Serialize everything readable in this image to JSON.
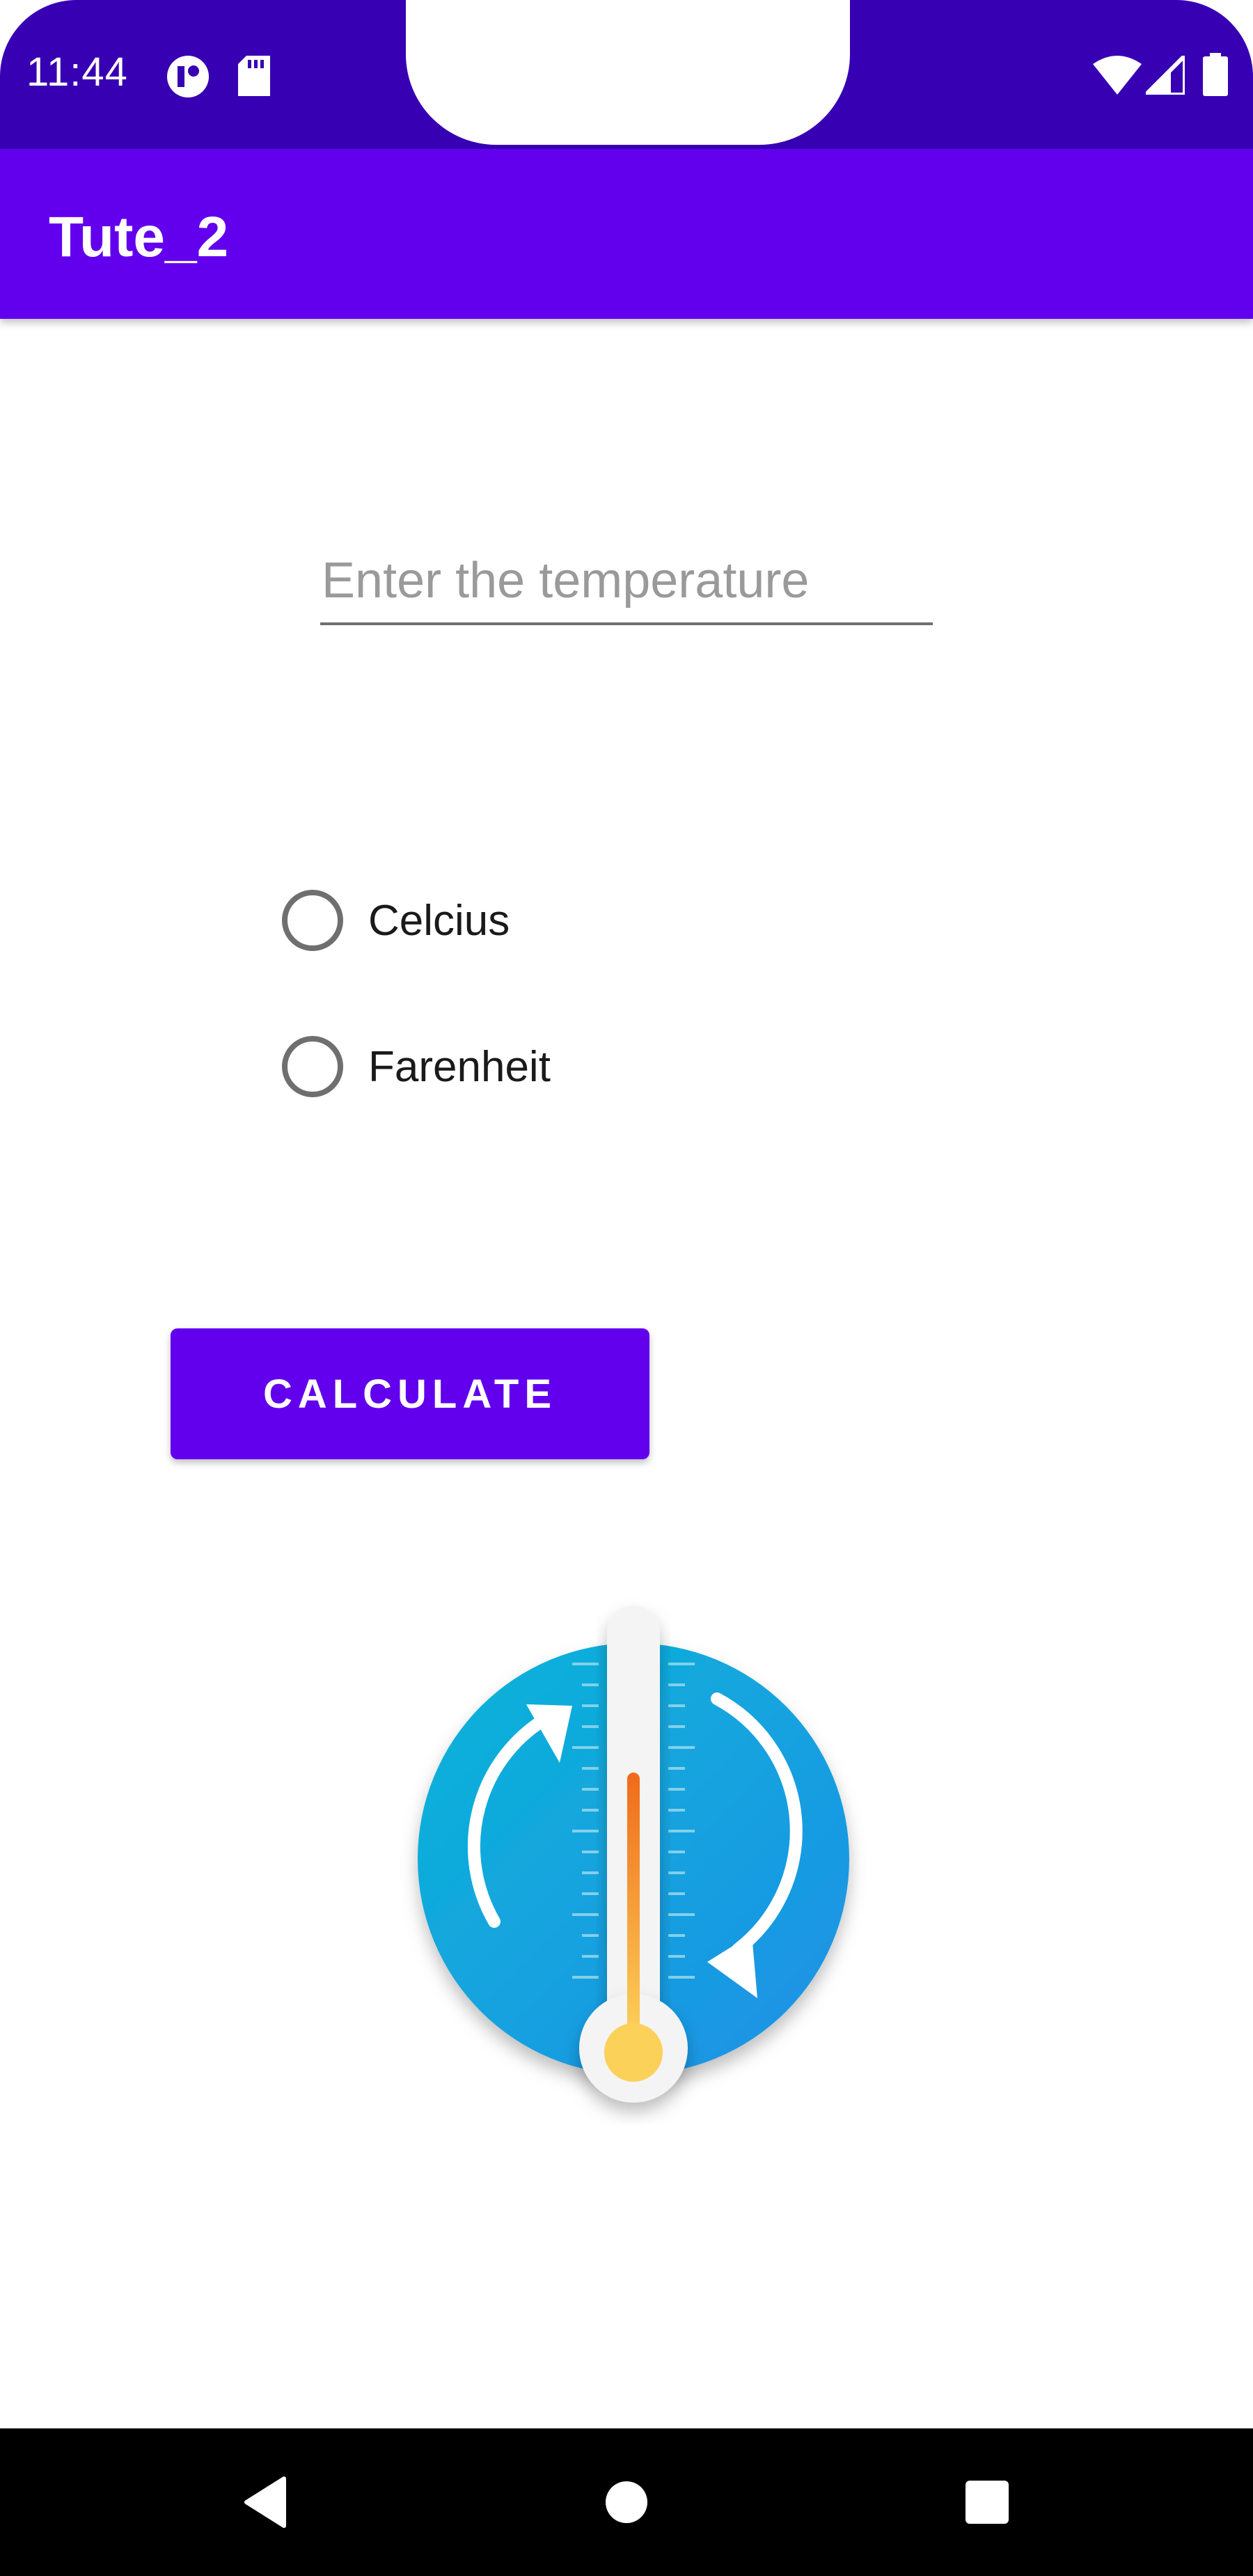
{
  "status_bar": {
    "time": "11:44",
    "icons": [
      "circle-app-icon",
      "sd-card-icon",
      "wifi-icon",
      "signal-icon",
      "battery-icon"
    ],
    "color": "#3700B3"
  },
  "app_bar": {
    "title": "Tute_2",
    "color": "#6200EE"
  },
  "form": {
    "temperature_input": {
      "value": "",
      "placeholder": "Enter the temperature"
    },
    "units": [
      {
        "label": "Celcius",
        "selected": false
      },
      {
        "label": "Farenheit",
        "selected": false
      }
    ],
    "calculate_label": "CALCULATE"
  },
  "image": {
    "icon": "thermometer-conversion-icon"
  },
  "nav_bar": {
    "icons": [
      "back-icon",
      "home-icon",
      "recents-icon"
    ]
  }
}
